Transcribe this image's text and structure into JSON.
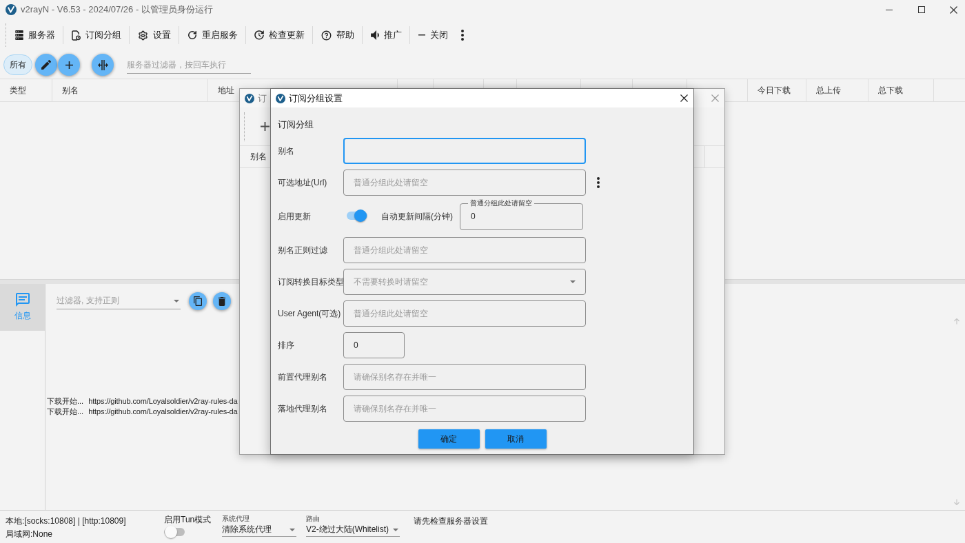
{
  "window": {
    "title": "v2rayN - V6.53 - 2024/07/26 - 以管理员身份运行"
  },
  "toolbar": [
    "服务器",
    "订阅分组",
    "设置",
    "重启服务",
    "检查更新",
    "帮助",
    "推广",
    "关闭"
  ],
  "server_filter": {
    "groups": [
      {
        "label": "所有",
        "selected": true
      }
    ],
    "placeholder": "服务器过滤器，按回车执行"
  },
  "server_table": {
    "columns": [
      "类型",
      "别名",
      "地址",
      "今日下载",
      "总上传",
      "总下载"
    ]
  },
  "log_panel": {
    "tabs": [
      {
        "label": "信息",
        "selected": true
      }
    ],
    "filter": {
      "placeholder": "过滤器, 支持正则"
    },
    "lines": [
      {
        "status": "下载开始...",
        "url": "https://github.com/Loyalsoldier/v2ray-rules-da"
      },
      {
        "status": "下载开始...",
        "url": "https://github.com/Loyalsoldier/v2ray-rules-da"
      }
    ]
  },
  "status_bar": {
    "ports": "本地:[socks:10808] | [http:10809]",
    "lan": "局域网:None",
    "tun": {
      "label": "启用Tun模式",
      "on": false
    },
    "system_proxy": {
      "label": "系统代理",
      "value": "清除系统代理"
    },
    "routing": {
      "label": "路由",
      "value": "V2-绕过大陆(Whitelist)"
    },
    "message": "请先检查服务器设置"
  },
  "background_dialog": {
    "title": "订",
    "columns": [
      "别名"
    ]
  },
  "dialog": {
    "title": "订阅分组设置",
    "section": "订阅分组",
    "fields": [
      {
        "kind": "text",
        "label": "别名",
        "focused": true
      },
      {
        "kind": "text_menu",
        "label": "可选地址(Url)",
        "placeholder": "普通分组此处请留空",
        "focused": false
      },
      {
        "kind": "toggle",
        "label": "启用更新",
        "on": true,
        "interval_label": "自动更新间隔(分钟)",
        "interval_hint": "普通分组此处请留空",
        "interval_value": "0"
      },
      {
        "kind": "text",
        "label": "别名正则过滤",
        "placeholder": "普通分组此处请留空",
        "focused": false
      },
      {
        "kind": "select",
        "label": "订阅转换目标类型",
        "placeholder": "不需要转换时请留空",
        "focused": false
      },
      {
        "kind": "text",
        "label": "User Agent(可选)",
        "placeholder": "普通分组此处请留空",
        "focused": false
      },
      {
        "kind": "number",
        "label": "排序",
        "value": "0",
        "focused": false
      },
      {
        "kind": "text",
        "label": "前置代理别名",
        "placeholder": "请确保别名存在并唯一",
        "focused": false
      },
      {
        "kind": "text",
        "label": "落地代理别名",
        "placeholder": "请确保别名存在并唯一",
        "focused": false
      }
    ],
    "buttons": [
      "确定",
      "取消"
    ]
  }
}
